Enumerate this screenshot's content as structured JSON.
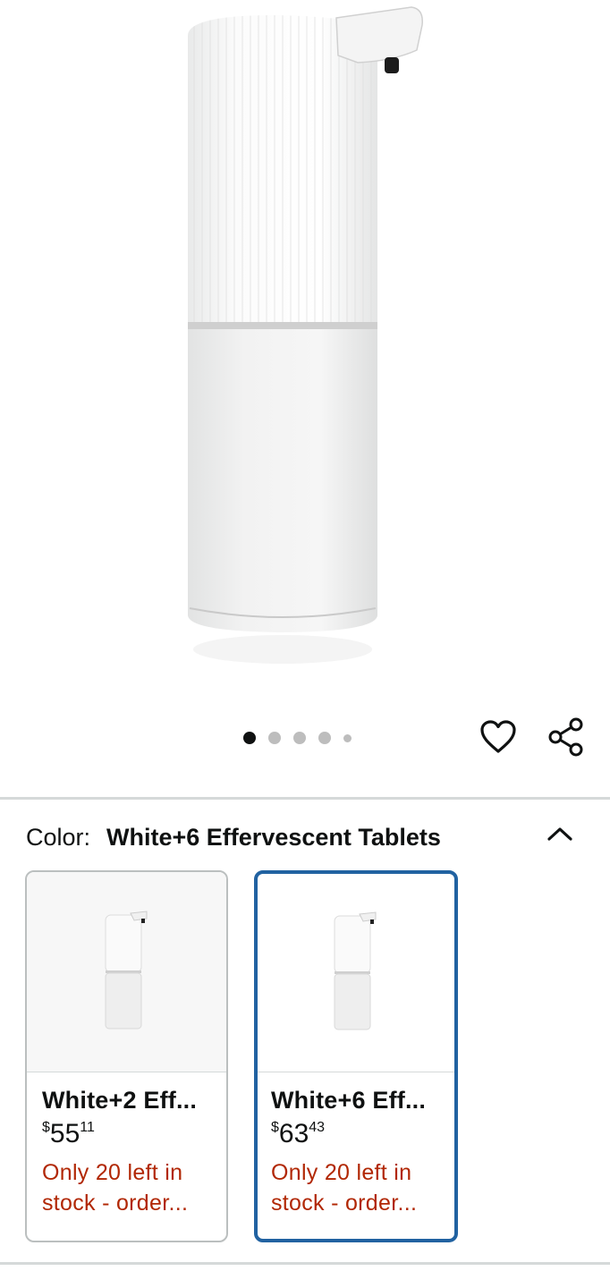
{
  "product": {
    "image_icon": "soap-dispenser-icon",
    "carousel": {
      "count": 5,
      "active_index": 0
    }
  },
  "actions": {
    "wishlist_icon": "heart-icon",
    "share_icon": "share-icon"
  },
  "color_selector": {
    "label": "Color:",
    "selected_value": "White+6 Effervescent Tablets",
    "collapse_icon": "chevron-up-icon"
  },
  "variants": [
    {
      "name": "White+2 Eff...",
      "currency": "$",
      "price_whole": "55",
      "price_fraction": "11",
      "stock_line1": "Only 20 left in",
      "stock_line2": "stock - order...",
      "selected": false
    },
    {
      "name": "White+6 Eff...",
      "currency": "$",
      "price_whole": "63",
      "price_fraction": "43",
      "stock_line1": "Only 20 left in",
      "stock_line2": "stock - order...",
      "selected": true
    }
  ],
  "colors": {
    "selected_border": "#2162a1",
    "stock_text": "#b12704",
    "divider": "#d5d9d9"
  }
}
